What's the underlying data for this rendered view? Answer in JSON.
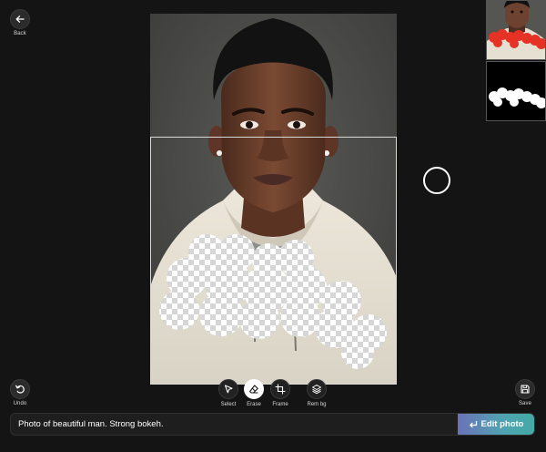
{
  "nav": {
    "back_label": "Back",
    "back_icon": "arrow-left-icon"
  },
  "history": {
    "undo_label": "Undo",
    "undo_icon": "undo-icon",
    "save_label": "Save",
    "save_icon": "floppy-disk-icon"
  },
  "tools": [
    {
      "label": "Select",
      "icon": "cursor-arrow-icon",
      "active": false
    },
    {
      "label": "Erase",
      "icon": "eraser-icon",
      "active": true
    },
    {
      "label": "Frame",
      "icon": "crop-frame-icon",
      "active": false
    },
    {
      "label": "Rem bg",
      "icon": "layers-icon",
      "active": false
    }
  ],
  "prompt": {
    "value": "Photo of beautiful man. Strong bokeh.",
    "button_label": "Edit photo",
    "button_icon": "enter-return-icon"
  },
  "colors": {
    "background": "#141414",
    "accent_gradient_start": "#6b72b8",
    "accent_gradient_end": "#43aaa6",
    "mask_stroke_thumbnail": "#e53224",
    "erased_checker_light": "#ffffff",
    "erased_checker_dark": "#d6d6d6"
  }
}
